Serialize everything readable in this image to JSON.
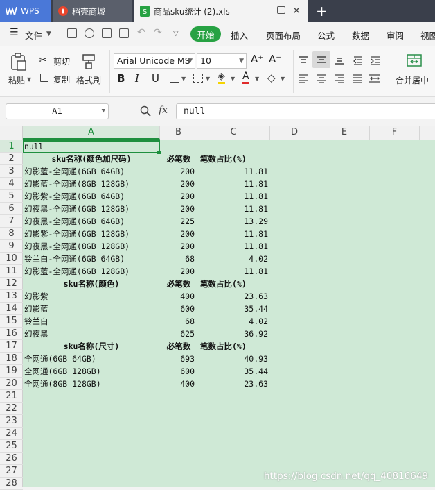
{
  "tabs": {
    "wps": "WPS",
    "daoke": "稻壳商城",
    "file": "商品sku统计 (2).xls",
    "new_tab": "+"
  },
  "menu": {
    "file": "文件",
    "start": "开始",
    "items": [
      "插入",
      "页面布局",
      "公式",
      "数据",
      "审阅",
      "视图"
    ]
  },
  "ribbon": {
    "paste": "粘贴",
    "cut": "剪切",
    "copy": "复制",
    "format_painter": "格式刷",
    "font_name": "Arial Unicode MS",
    "font_size": "10",
    "grow_font": "A⁺",
    "shrink_font": "A⁻",
    "merge_center": "合并居中"
  },
  "formula_bar": {
    "cell_ref": "A1",
    "fx": "fx",
    "value": "null"
  },
  "columns": [
    "A",
    "B",
    "C",
    "D",
    "E",
    "F"
  ],
  "rows": [
    "1",
    "2",
    "3",
    "4",
    "5",
    "6",
    "7",
    "8",
    "9",
    "10",
    "11",
    "12",
    "13",
    "14",
    "15",
    "16",
    "17",
    "18",
    "19",
    "20",
    "21",
    "22",
    "23",
    "24",
    "25",
    "26",
    "27",
    "28"
  ],
  "sheet": {
    "a1": "null",
    "table1": {
      "header": [
        "sku名称(颜色加尺码)",
        "必笔数",
        "笔数占比(%)"
      ],
      "rows": [
        [
          "幻影蓝-全网通(6GB 64GB)",
          "200",
          "11.81"
        ],
        [
          "幻影蓝-全网通(8GB 128GB)",
          "200",
          "11.81"
        ],
        [
          "幻影紫-全网通(6GB 64GB)",
          "200",
          "11.81"
        ],
        [
          "幻夜黑-全网通(6GB 128GB)",
          "200",
          "11.81"
        ],
        [
          "幻夜黑-全网通(6GB 64GB)",
          "225",
          "13.29"
        ],
        [
          "幻影紫-全网通(6GB 128GB)",
          "200",
          "11.81"
        ],
        [
          "幻夜黑-全网通(8GB 128GB)",
          "200",
          "11.81"
        ],
        [
          "铃兰白-全网通(6GB 64GB)",
          "68",
          "4.02"
        ],
        [
          "幻影蓝-全网通(6GB 128GB)",
          "200",
          "11.81"
        ]
      ]
    },
    "table2": {
      "header": [
        "sku名称(颜色)",
        "必笔数",
        "笔数占比(%)"
      ],
      "rows": [
        [
          "幻影紫",
          "400",
          "23.63"
        ],
        [
          "幻影蓝",
          "600",
          "35.44"
        ],
        [
          "铃兰白",
          "68",
          "4.02"
        ],
        [
          "幻夜黑",
          "625",
          "36.92"
        ]
      ]
    },
    "table3": {
      "header": [
        "sku名称(尺寸)",
        "必笔数",
        "笔数占比(%)"
      ],
      "rows": [
        [
          "全网通(6GB 64GB)",
          "693",
          "40.93"
        ],
        [
          "全网通(6GB 128GB)",
          "600",
          "35.44"
        ],
        [
          "全网通(8GB 128GB)",
          "400",
          "23.63"
        ]
      ]
    }
  },
  "watermark": "https://blog.csdn.net/qq_40816649"
}
